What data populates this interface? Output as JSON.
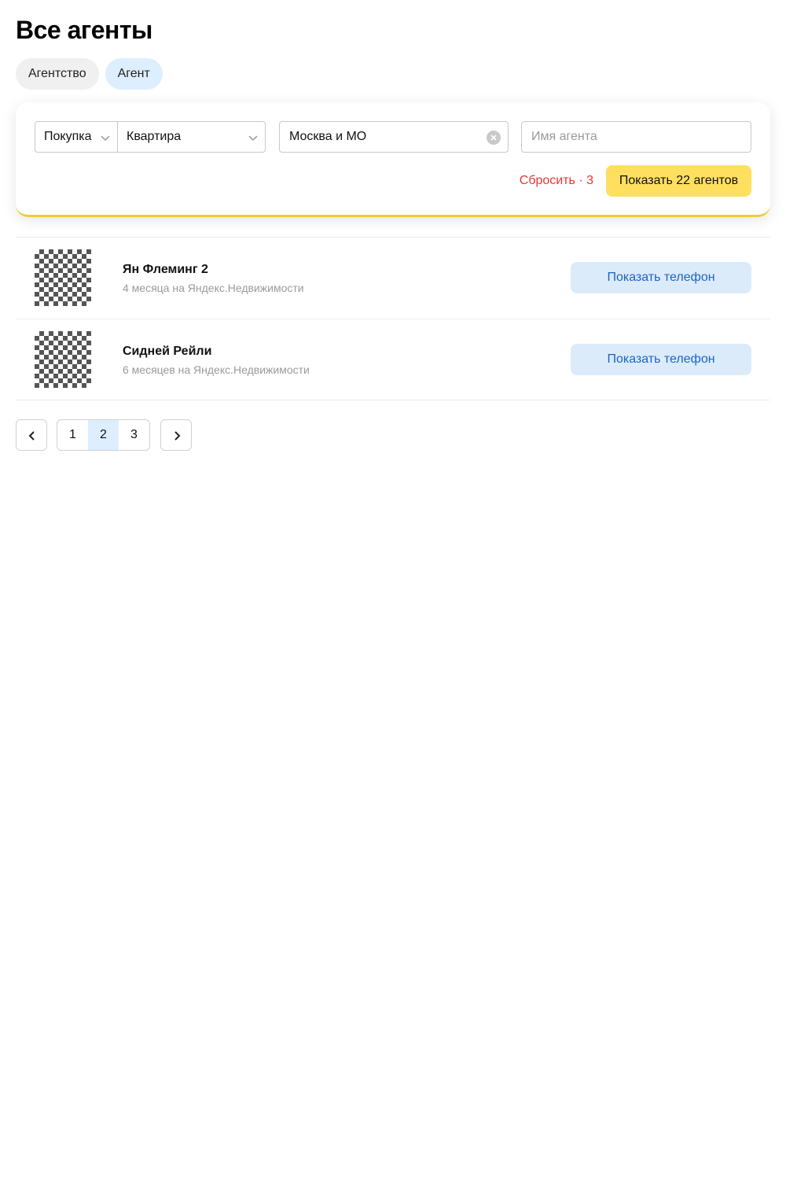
{
  "page": {
    "title": "Все агенты"
  },
  "type_tabs": [
    {
      "label": "Агентство",
      "active": false
    },
    {
      "label": "Агент",
      "active": true
    }
  ],
  "filters": {
    "deal_type": "Покупка",
    "property_type": "Квартира",
    "region": "Москва и МО",
    "agent_name_placeholder": "Имя агента",
    "reset_label": "Сбросить · 3",
    "show_button_label": "Показать 22 агентов"
  },
  "agents": [
    {
      "name": "Ян Флеминг 2",
      "subtitle": "4 месяца на Яндекс.Недвижимости",
      "phone_button": "Показать телефон"
    },
    {
      "name": "Сидней Рейли",
      "subtitle": "6 месяцев на Яндекс.Недвижимости",
      "phone_button": "Показать телефон"
    }
  ],
  "pagination": {
    "pages": [
      "1",
      "2",
      "3"
    ],
    "current": "2",
    "prev_icon": "chevron-left-icon",
    "next_icon": "chevron-right-icon"
  },
  "colors": {
    "accent_yellow": "#ffdf60",
    "active_tab": "#ddeeff",
    "phone_button_bg": "#dcebfa",
    "phone_button_text": "#1a64c8",
    "reset_red": "#e8362f"
  }
}
